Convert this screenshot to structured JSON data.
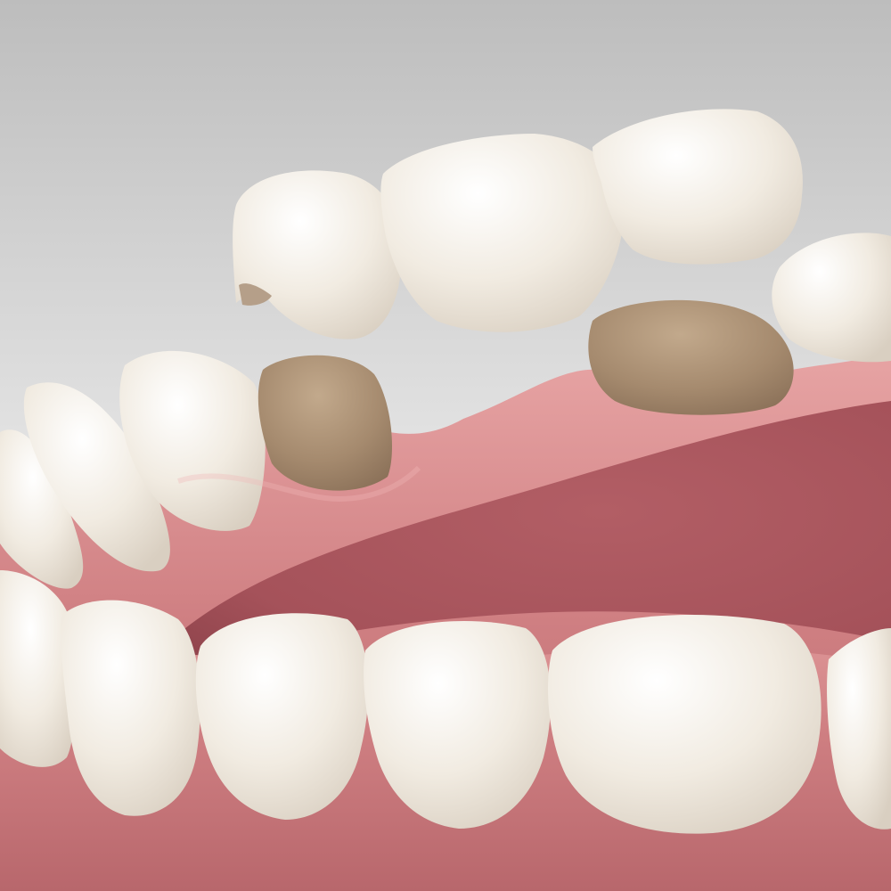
{
  "image": {
    "subject": "dental-bridge-illustration",
    "colors": {
      "background_top": "#bdbdbd",
      "background_bottom": "#ffffff",
      "gum": "#cf7f82",
      "gum_dark": "#b8676c",
      "gum_highlight": "#e7a4a4",
      "tongue_area": "#a5525a",
      "tongue_dark": "#8e434b",
      "tooth": "#f1ebe1",
      "tooth_shadow": "#d9cfc1",
      "tooth_highlight": "#ffffff",
      "abutment": "#a58a6e",
      "abutment_light": "#c2a98c",
      "abutment_dark": "#8a7058",
      "crown_inner": "#b59f89"
    }
  }
}
